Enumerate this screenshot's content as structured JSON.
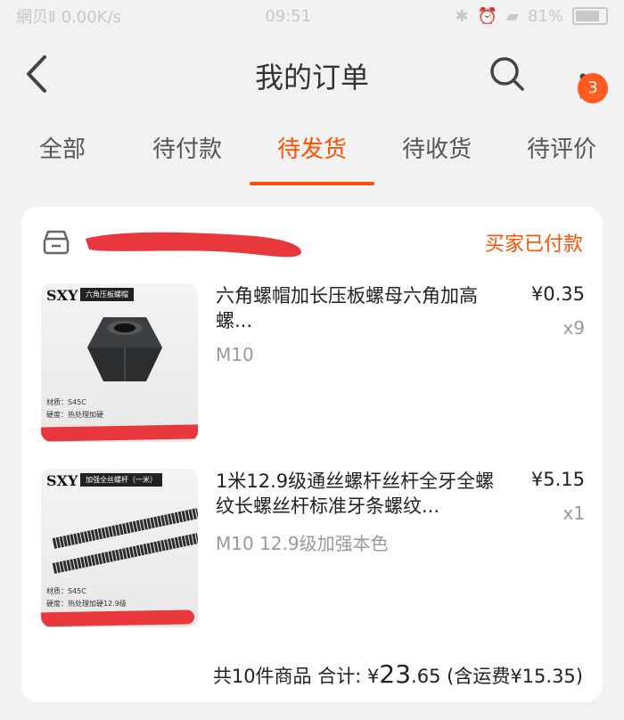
{
  "status_bar": {
    "left": "網贝Ⅱ 0.00K/s",
    "time": "09:51",
    "battery": "81%"
  },
  "header": {
    "title": "我的订单",
    "badge_count": "3"
  },
  "tabs": [
    {
      "label": "全部",
      "active": false
    },
    {
      "label": "待付款",
      "active": false
    },
    {
      "label": "待发货",
      "active": true
    },
    {
      "label": "待收货",
      "active": false
    },
    {
      "label": "待评价",
      "active": false
    }
  ],
  "order": {
    "status": "买家已付款",
    "items": [
      {
        "title": "六角螺帽加长压板螺母六角加高螺...",
        "sku": "M10",
        "price": "¥0.35",
        "qty": "x9",
        "thumb_brand": "SXY",
        "thumb_tag": "六角压板螺帽",
        "thumb_spec1": "材质：S45C",
        "thumb_spec2": "硬度：热处理加硬"
      },
      {
        "title": "1米12.9级通丝螺杆丝杆全牙全螺纹长螺丝杆标准牙条螺纹...",
        "sku": "M10 12.9级加强本色",
        "price": "¥5.15",
        "qty": "x1",
        "thumb_brand": "SXY",
        "thumb_tag": "加强全丝螺杆（一米）",
        "thumb_spec1": "材质：S45C",
        "thumb_spec2": "硬度：热处理加硬12.9级"
      }
    ],
    "summary": {
      "count_text": "共10件商品",
      "total_label": "合计:",
      "currency": "¥",
      "total_int": "23",
      "total_dec": ".65",
      "shipping": "(含运费¥15.35)"
    }
  },
  "colors": {
    "accent": "#ff5000",
    "badge": "#ff5a1f",
    "redaction": "#e8383d"
  }
}
